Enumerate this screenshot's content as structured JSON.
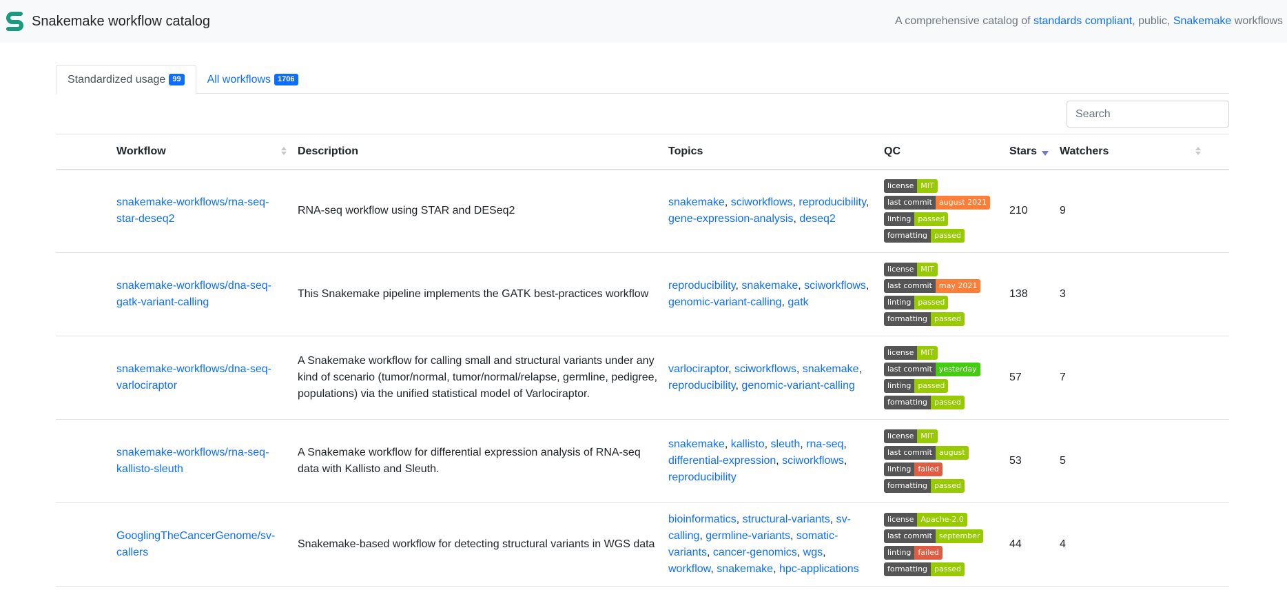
{
  "navbar": {
    "title": "Snakemake workflow catalog",
    "tagline": {
      "prefix": "A comprehensive catalog of ",
      "link1": "standards compliant",
      "middle": ", public, ",
      "link2": "Snakemake",
      "suffix": " workflows"
    }
  },
  "tabs": [
    {
      "label": "Standardized usage",
      "count": "99",
      "active": true
    },
    {
      "label": "All workflows",
      "count": "1706",
      "active": false
    }
  ],
  "search": {
    "placeholder": "Search",
    "value": ""
  },
  "table": {
    "headers": {
      "workflow": "Workflow",
      "description": "Description",
      "topics": "Topics",
      "qc": "QC",
      "stars": "Stars",
      "watchers": "Watchers"
    },
    "sort": {
      "column": "stars",
      "direction": "descending"
    },
    "rows": [
      {
        "workflow": "snakemake-workflows/rna-seq-star-deseq2",
        "description": "RNA-seq workflow using STAR and DESeq2",
        "topics": [
          "snakemake",
          "sciworkflows",
          "reproducibility",
          "gene-expression-analysis",
          "deseq2"
        ],
        "qc": [
          {
            "key": "license",
            "value": "MIT",
            "color": "green"
          },
          {
            "key": "last commit",
            "value": "august 2021",
            "color": "orange"
          },
          {
            "key": "linting",
            "value": "passed",
            "color": "green"
          },
          {
            "key": "formatting",
            "value": "passed",
            "color": "green"
          }
        ],
        "stars": "210",
        "watchers": "9"
      },
      {
        "workflow": "snakemake-workflows/dna-seq-gatk-variant-calling",
        "description": "This Snakemake pipeline implements the GATK best-practices workflow",
        "topics": [
          "reproducibility",
          "snakemake",
          "sciworkflows",
          "genomic-variant-calling",
          "gatk"
        ],
        "qc": [
          {
            "key": "license",
            "value": "MIT",
            "color": "green"
          },
          {
            "key": "last commit",
            "value": "may 2021",
            "color": "orange"
          },
          {
            "key": "linting",
            "value": "passed",
            "color": "green"
          },
          {
            "key": "formatting",
            "value": "passed",
            "color": "green"
          }
        ],
        "stars": "138",
        "watchers": "3"
      },
      {
        "workflow": "snakemake-workflows/dna-seq-varlociraptor",
        "description": "A Snakemake workflow for calling small and structural variants under any kind of scenario (tumor/normal, tumor/normal/relapse, germline, pedigree, populations) via the unified statistical model of Varlociraptor.",
        "topics": [
          "varlociraptor",
          "sciworkflows",
          "snakemake",
          "reproducibility",
          "genomic-variant-calling"
        ],
        "qc": [
          {
            "key": "license",
            "value": "MIT",
            "color": "green"
          },
          {
            "key": "last commit",
            "value": "yesterday",
            "color": "brightgreen"
          },
          {
            "key": "linting",
            "value": "passed",
            "color": "green"
          },
          {
            "key": "formatting",
            "value": "passed",
            "color": "green"
          }
        ],
        "stars": "57",
        "watchers": "7"
      },
      {
        "workflow": "snakemake-workflows/rna-seq-kallisto-sleuth",
        "description": "A Snakemake workflow for differential expression analysis of RNA-seq data with Kallisto and Sleuth.",
        "topics": [
          "snakemake",
          "kallisto",
          "sleuth",
          "rna-seq",
          "differential-expression",
          "sciworkflows",
          "reproducibility"
        ],
        "qc": [
          {
            "key": "license",
            "value": "MIT",
            "color": "green"
          },
          {
            "key": "last commit",
            "value": "august",
            "color": "green"
          },
          {
            "key": "linting",
            "value": "failed",
            "color": "red"
          },
          {
            "key": "formatting",
            "value": "passed",
            "color": "green"
          }
        ],
        "stars": "53",
        "watchers": "5"
      },
      {
        "workflow": "GooglingTheCancerGenome/sv-callers",
        "description": "Snakemake-based workflow for detecting structural variants in WGS data",
        "topics": [
          "bioinformatics",
          "structural-variants",
          "sv-calling",
          "germline-variants",
          "somatic-variants",
          "cancer-genomics",
          "wgs",
          "workflow",
          "snakemake",
          "hpc-applications"
        ],
        "qc": [
          {
            "key": "license",
            "value": "Apache-2.0",
            "color": "green"
          },
          {
            "key": "last commit",
            "value": "september",
            "color": "green"
          },
          {
            "key": "linting",
            "value": "failed",
            "color": "red"
          },
          {
            "key": "formatting",
            "value": "passed",
            "color": "green"
          }
        ],
        "stars": "44",
        "watchers": "4"
      }
    ]
  },
  "icons": {
    "brand": "snakemake-logo-icon",
    "sort": "sort-icon"
  }
}
